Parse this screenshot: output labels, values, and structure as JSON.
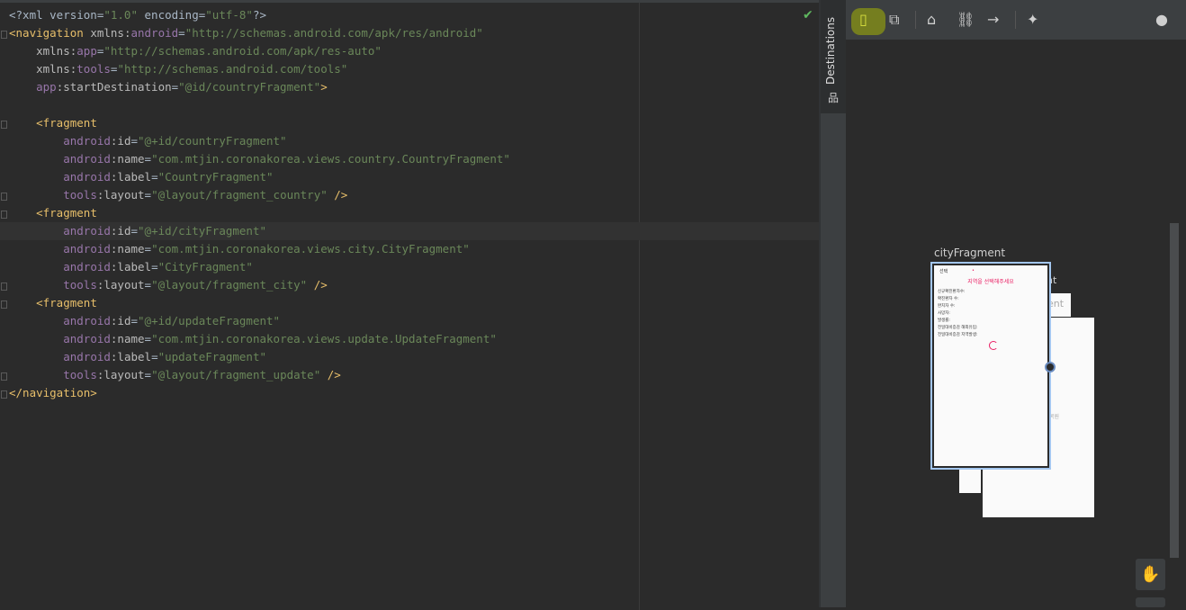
{
  "editor": {
    "lines": [
      [
        {
          "c": "pl",
          "t": "<?xml version="
        },
        {
          "c": "v",
          "t": "\"1.0\""
        },
        {
          "c": "pl",
          "t": " encoding="
        },
        {
          "c": "v",
          "t": "\"utf-8\""
        },
        {
          "c": "pl",
          "t": "?>"
        }
      ],
      [
        {
          "c": "t",
          "t": "<navigation "
        },
        {
          "c": "a",
          "t": "xmlns:"
        },
        {
          "c": "ns",
          "t": "android"
        },
        {
          "c": "pl",
          "t": "="
        },
        {
          "c": "v",
          "t": "\"http://schemas.android.com/apk/res/android\""
        }
      ],
      [
        {
          "c": "pl",
          "t": "    "
        },
        {
          "c": "a",
          "t": "xmlns:"
        },
        {
          "c": "ns",
          "t": "app"
        },
        {
          "c": "pl",
          "t": "="
        },
        {
          "c": "v",
          "t": "\"http://schemas.android.com/apk/res-auto\""
        }
      ],
      [
        {
          "c": "pl",
          "t": "    "
        },
        {
          "c": "a",
          "t": "xmlns:"
        },
        {
          "c": "ns",
          "t": "tools"
        },
        {
          "c": "pl",
          "t": "="
        },
        {
          "c": "v",
          "t": "\"http://schemas.android.com/tools\""
        }
      ],
      [
        {
          "c": "pl",
          "t": "    "
        },
        {
          "c": "ns",
          "t": "app"
        },
        {
          "c": "a",
          "t": ":startDestination"
        },
        {
          "c": "pl",
          "t": "="
        },
        {
          "c": "v",
          "t": "\"@id/countryFragment\""
        },
        {
          "c": "t",
          "t": ">"
        }
      ],
      [],
      [
        {
          "c": "pl",
          "t": "    "
        },
        {
          "c": "t",
          "t": "<fragment"
        }
      ],
      [
        {
          "c": "pl",
          "t": "        "
        },
        {
          "c": "ns",
          "t": "android"
        },
        {
          "c": "a",
          "t": ":id"
        },
        {
          "c": "pl",
          "t": "="
        },
        {
          "c": "v",
          "t": "\"@+id/countryFragment\""
        }
      ],
      [
        {
          "c": "pl",
          "t": "        "
        },
        {
          "c": "ns",
          "t": "android"
        },
        {
          "c": "a",
          "t": ":name"
        },
        {
          "c": "pl",
          "t": "="
        },
        {
          "c": "v",
          "t": "\"com.mtjin.coronakorea.views.country.CountryFragment\""
        }
      ],
      [
        {
          "c": "pl",
          "t": "        "
        },
        {
          "c": "ns",
          "t": "android"
        },
        {
          "c": "a",
          "t": ":label"
        },
        {
          "c": "pl",
          "t": "="
        },
        {
          "c": "v",
          "t": "\"CountryFragment\""
        }
      ],
      [
        {
          "c": "pl",
          "t": "        "
        },
        {
          "c": "ns",
          "t": "tools"
        },
        {
          "c": "a",
          "t": ":layout"
        },
        {
          "c": "pl",
          "t": "="
        },
        {
          "c": "v",
          "t": "\"@layout/fragment_country\""
        },
        {
          "c": "t",
          "t": " />"
        }
      ],
      [
        {
          "c": "pl",
          "t": "    "
        },
        {
          "c": "t",
          "t": "<fragment"
        }
      ],
      [
        {
          "c": "pl",
          "t": "        "
        },
        {
          "c": "ns",
          "t": "android"
        },
        {
          "c": "a",
          "t": ":id"
        },
        {
          "c": "pl",
          "t": "="
        },
        {
          "c": "v",
          "t": "\"@+id/cityFragment\""
        }
      ],
      [
        {
          "c": "pl",
          "t": "        "
        },
        {
          "c": "ns",
          "t": "android"
        },
        {
          "c": "a",
          "t": ":name"
        },
        {
          "c": "pl",
          "t": "="
        },
        {
          "c": "v",
          "t": "\"com.mtjin.coronakorea.views.city.CityFragment\""
        }
      ],
      [
        {
          "c": "pl",
          "t": "        "
        },
        {
          "c": "ns",
          "t": "android"
        },
        {
          "c": "a",
          "t": ":label"
        },
        {
          "c": "pl",
          "t": "="
        },
        {
          "c": "v",
          "t": "\"CityFragment\""
        }
      ],
      [
        {
          "c": "pl",
          "t": "        "
        },
        {
          "c": "ns",
          "t": "tools"
        },
        {
          "c": "a",
          "t": ":layout"
        },
        {
          "c": "pl",
          "t": "="
        },
        {
          "c": "v",
          "t": "\"@layout/fragment_city\""
        },
        {
          "c": "t",
          "t": " />"
        }
      ],
      [
        {
          "c": "pl",
          "t": "    "
        },
        {
          "c": "t",
          "t": "<fragment"
        }
      ],
      [
        {
          "c": "pl",
          "t": "        "
        },
        {
          "c": "ns",
          "t": "android"
        },
        {
          "c": "a",
          "t": ":id"
        },
        {
          "c": "pl",
          "t": "="
        },
        {
          "c": "v",
          "t": "\"@+id/updateFragment\""
        }
      ],
      [
        {
          "c": "pl",
          "t": "        "
        },
        {
          "c": "ns",
          "t": "android"
        },
        {
          "c": "a",
          "t": ":name"
        },
        {
          "c": "pl",
          "t": "="
        },
        {
          "c": "v",
          "t": "\"com.mtjin.coronakorea.views.update.UpdateFragment\""
        }
      ],
      [
        {
          "c": "pl",
          "t": "        "
        },
        {
          "c": "ns",
          "t": "android"
        },
        {
          "c": "a",
          "t": ":label"
        },
        {
          "c": "pl",
          "t": "="
        },
        {
          "c": "v",
          "t": "\"updateFragment\""
        }
      ],
      [
        {
          "c": "pl",
          "t": "        "
        },
        {
          "c": "ns",
          "t": "tools"
        },
        {
          "c": "a",
          "t": ":layout"
        },
        {
          "c": "pl",
          "t": "="
        },
        {
          "c": "v",
          "t": "\"@layout/fragment_update\""
        },
        {
          "c": "t",
          "t": " />"
        }
      ],
      [
        {
          "c": "t",
          "t": "</navigation>"
        }
      ]
    ],
    "current_line": 12
  },
  "side_panel": {
    "tab_label": "Destinations"
  },
  "toolbar": {
    "new_destination_icon": "new-destination-icon",
    "nested_graph_icon": "nested-graph-icon",
    "home_icon": "home-icon",
    "deeplink_icon": "link-icon",
    "action_icon": "arrow-right-icon",
    "auto_arrange_icon": "sparkle-icon",
    "warning_icon": "warning-icon"
  },
  "graph": {
    "selected_label": "cityFragment",
    "behind_label": "nt",
    "behind_label2": "ent",
    "behind_text": "복원",
    "phone": {
      "top_left": "선택",
      "top_dot": "•",
      "title": "지역을 선택해주세요",
      "rows": [
        "신규확진환자수:",
        "확진환자 수:",
        "완치자 수:",
        "사망자:",
        "발생률:",
        "전일대비증감 해외유입:",
        "전일대비증감 지역발생:"
      ]
    }
  },
  "colors": {
    "accent_pink": "#e91e63",
    "selection_blue": "#a3c6ef",
    "highlight": "#7f8a1a"
  }
}
